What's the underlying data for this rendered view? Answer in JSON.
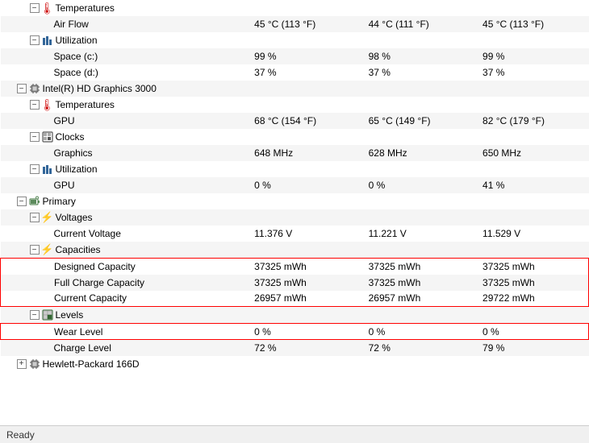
{
  "status_bar": {
    "label": "Ready"
  },
  "columns": [
    "col1",
    "col2",
    "col3"
  ],
  "rows": [
    {
      "id": "row-temperatures-1",
      "indent": 2,
      "expand": "minus",
      "icon": "temp",
      "label": "Temperatures",
      "v1": "",
      "v2": "",
      "v3": "",
      "highlighted": false
    },
    {
      "id": "row-airflow",
      "indent": 3,
      "expand": "none",
      "icon": "none",
      "label": "Air Flow",
      "v1": "45 °C (113 °F)",
      "v2": "44 °C (111 °F)",
      "v3": "45 °C (113 °F)",
      "highlighted": false
    },
    {
      "id": "row-utilization-1",
      "indent": 2,
      "expand": "minus",
      "icon": "util",
      "label": "Utilization",
      "v1": "",
      "v2": "",
      "v3": "",
      "highlighted": false
    },
    {
      "id": "row-space-c",
      "indent": 3,
      "expand": "none",
      "icon": "none",
      "label": "Space (c:)",
      "v1": "99 %",
      "v2": "98 %",
      "v3": "99 %",
      "highlighted": false
    },
    {
      "id": "row-space-d",
      "indent": 3,
      "expand": "none",
      "icon": "none",
      "label": "Space (d:)",
      "v1": "37 %",
      "v2": "37 %",
      "v3": "37 %",
      "highlighted": false
    },
    {
      "id": "row-intel-hd",
      "indent": 1,
      "expand": "minus",
      "icon": "chip",
      "label": "Intel(R) HD Graphics 3000",
      "v1": "",
      "v2": "",
      "v3": "",
      "highlighted": false
    },
    {
      "id": "row-temperatures-2",
      "indent": 2,
      "expand": "minus",
      "icon": "temp",
      "label": "Temperatures",
      "v1": "",
      "v2": "",
      "v3": "",
      "highlighted": false
    },
    {
      "id": "row-gpu-temp",
      "indent": 3,
      "expand": "none",
      "icon": "none",
      "label": "GPU",
      "v1": "68 °C (154 °F)",
      "v2": "65 °C (149 °F)",
      "v3": "82 °C (179 °F)",
      "highlighted": false
    },
    {
      "id": "row-clocks",
      "indent": 2,
      "expand": "minus",
      "icon": "clock",
      "label": "Clocks",
      "v1": "",
      "v2": "",
      "v3": "",
      "highlighted": false
    },
    {
      "id": "row-graphics",
      "indent": 3,
      "expand": "none",
      "icon": "none",
      "label": "Graphics",
      "v1": "648 MHz",
      "v2": "628 MHz",
      "v3": "650 MHz",
      "highlighted": false
    },
    {
      "id": "row-utilization-2",
      "indent": 2,
      "expand": "minus",
      "icon": "util",
      "label": "Utilization",
      "v1": "",
      "v2": "",
      "v3": "",
      "highlighted": false
    },
    {
      "id": "row-gpu-util",
      "indent": 3,
      "expand": "none",
      "icon": "none",
      "label": "GPU",
      "v1": "0 %",
      "v2": "0 %",
      "v3": "41 %",
      "highlighted": false
    },
    {
      "id": "row-primary",
      "indent": 1,
      "expand": "minus",
      "icon": "battery",
      "label": "Primary",
      "v1": "",
      "v2": "",
      "v3": "",
      "highlighted": false
    },
    {
      "id": "row-voltages",
      "indent": 2,
      "expand": "minus",
      "icon": "voltage",
      "label": "Voltages",
      "v1": "",
      "v2": "",
      "v3": "",
      "highlighted": false
    },
    {
      "id": "row-current-voltage",
      "indent": 3,
      "expand": "none",
      "icon": "none",
      "label": "Current Voltage",
      "v1": "11.376 V",
      "v2": "11.221 V",
      "v3": "11.529 V",
      "highlighted": false
    },
    {
      "id": "row-capacities",
      "indent": 2,
      "expand": "minus",
      "icon": "cap",
      "label": "Capacities",
      "v1": "",
      "v2": "",
      "v3": "",
      "highlighted": false
    },
    {
      "id": "row-designed-cap",
      "indent": 3,
      "expand": "none",
      "icon": "none",
      "label": "Designed Capacity",
      "v1": "37325 mWh",
      "v2": "37325 mWh",
      "v3": "37325 mWh",
      "highlighted": true,
      "border_top": true,
      "border_bottom": false
    },
    {
      "id": "row-full-charge",
      "indent": 3,
      "expand": "none",
      "icon": "none",
      "label": "Full Charge Capacity",
      "v1": "37325 mWh",
      "v2": "37325 mWh",
      "v3": "37325 mWh",
      "highlighted": true,
      "border_top": false,
      "border_bottom": false
    },
    {
      "id": "row-current-cap",
      "indent": 3,
      "expand": "none",
      "icon": "none",
      "label": "Current Capacity",
      "v1": "26957 mWh",
      "v2": "26957 mWh",
      "v3": "29722 mWh",
      "highlighted": true,
      "border_top": false,
      "border_bottom": true
    },
    {
      "id": "row-levels",
      "indent": 2,
      "expand": "minus",
      "icon": "levels",
      "label": "Levels",
      "v1": "",
      "v2": "",
      "v3": "",
      "highlighted": false
    },
    {
      "id": "row-wear-level",
      "indent": 3,
      "expand": "none",
      "icon": "none",
      "label": "Wear Level",
      "v1": "0 %",
      "v2": "0 %",
      "v3": "0 %",
      "highlighted": true,
      "border_top": true,
      "border_bottom": true,
      "single_row_border": true
    },
    {
      "id": "row-charge-level",
      "indent": 3,
      "expand": "none",
      "icon": "none",
      "label": "Charge Level",
      "v1": "72 %",
      "v2": "72 %",
      "v3": "79 %",
      "highlighted": false
    },
    {
      "id": "row-hewlett",
      "indent": 1,
      "expand": "plus",
      "icon": "chip2",
      "label": "Hewlett-Packard 166D",
      "v1": "",
      "v2": "",
      "v3": "",
      "highlighted": false
    }
  ]
}
